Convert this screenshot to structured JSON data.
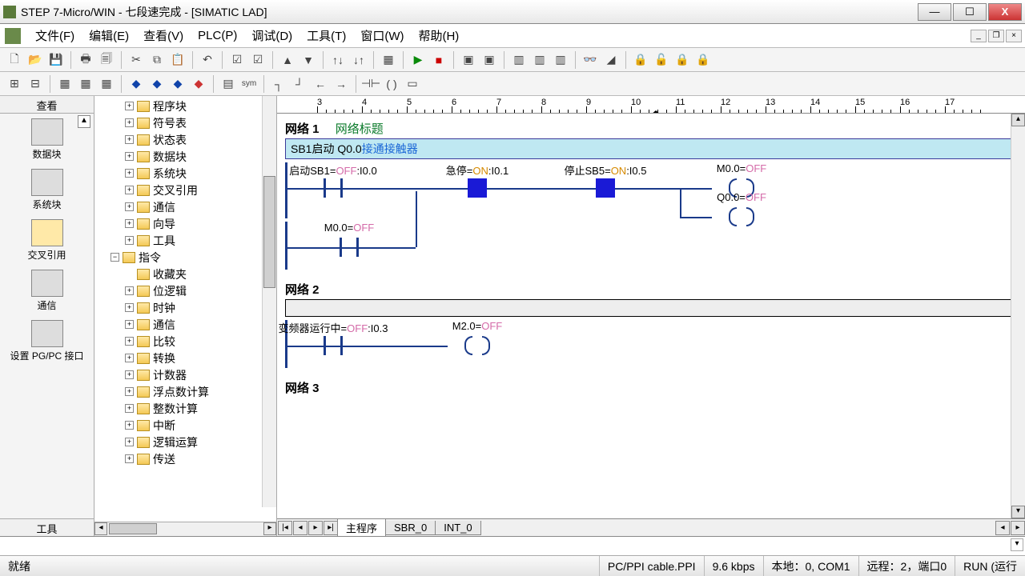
{
  "titlebar": {
    "text": "STEP 7-Micro/WIN - 七段速完成 - [SIMATIC LAD]"
  },
  "menu": {
    "file": "文件(F)",
    "edit": "编辑(E)",
    "view": "查看(V)",
    "plc": "PLC(P)",
    "debug": "调试(D)",
    "tools": "工具(T)",
    "window": "窗口(W)",
    "help": "帮助(H)"
  },
  "left_nav": {
    "title": "查看",
    "footer": "工具",
    "items": [
      {
        "label": "数据块"
      },
      {
        "label": "系统块"
      },
      {
        "label": "交叉引用"
      },
      {
        "label": "通信"
      },
      {
        "label": "设置 PG/PC 接口"
      }
    ]
  },
  "tree": [
    {
      "label": "程序块",
      "depth": 2,
      "exp": "+"
    },
    {
      "label": "符号表",
      "depth": 2,
      "exp": "+"
    },
    {
      "label": "状态表",
      "depth": 2,
      "exp": "+"
    },
    {
      "label": "数据块",
      "depth": 2,
      "exp": "+"
    },
    {
      "label": "系统块",
      "depth": 2,
      "exp": "+"
    },
    {
      "label": "交叉引用",
      "depth": 2,
      "exp": "+"
    },
    {
      "label": "通信",
      "depth": 2,
      "exp": "+"
    },
    {
      "label": "向导",
      "depth": 2,
      "exp": "+"
    },
    {
      "label": "工具",
      "depth": 2,
      "exp": "+"
    },
    {
      "label": "指令",
      "depth": 1,
      "exp": "−"
    },
    {
      "label": "收藏夹",
      "depth": 2,
      "exp": ""
    },
    {
      "label": "位逻辑",
      "depth": 2,
      "exp": "+"
    },
    {
      "label": "时钟",
      "depth": 2,
      "exp": "+"
    },
    {
      "label": "通信",
      "depth": 2,
      "exp": "+"
    },
    {
      "label": "比较",
      "depth": 2,
      "exp": "+"
    },
    {
      "label": "转换",
      "depth": 2,
      "exp": "+"
    },
    {
      "label": "计数器",
      "depth": 2,
      "exp": "+"
    },
    {
      "label": "浮点数计算",
      "depth": 2,
      "exp": "+"
    },
    {
      "label": "整数计算",
      "depth": 2,
      "exp": "+"
    },
    {
      "label": "中断",
      "depth": 2,
      "exp": "+"
    },
    {
      "label": "逻辑运算",
      "depth": 2,
      "exp": "+"
    },
    {
      "label": "传送",
      "depth": 2,
      "exp": "+"
    }
  ],
  "ruler": [
    "3",
    "4",
    "5",
    "6",
    "7",
    "8",
    "9",
    "10",
    "11",
    "12",
    "13",
    "14",
    "15",
    "16",
    "17"
  ],
  "networks": {
    "n1": {
      "title": "网络 1",
      "label": "网络标题",
      "comment_pre": "SB1启动 Q0.0",
      "comment_hl": "接通接触器",
      "c1": "启动SB1=",
      "c1s": "OFF",
      "c1a": ":I0.0",
      "c2": "急停=",
      "c2s": "ON",
      "c2a": ":I0.1",
      "c3": "停止SB5=",
      "c3s": "ON",
      "c3a": ":I0.5",
      "o1": "M0.0=",
      "o1s": "OFF",
      "p1": "M0.0=",
      "p1s": "OFF",
      "o2": "Q0.0=",
      "o2s": "OFF"
    },
    "n2": {
      "title": "网络 2",
      "c1": "变频器运行中=",
      "c1s": "OFF",
      "c1a": ":I0.3",
      "o1": "M2.0=",
      "o1s": "OFF"
    },
    "n3": {
      "title": "网络 3"
    }
  },
  "tabs": {
    "main": "主程序",
    "sbr": "SBR_0",
    "int": "INT_0"
  },
  "status": {
    "ready": "就绪",
    "cable": "PC/PPI cable.PPI",
    "baud": "9.6 kbps",
    "local": "本地：0, COM1",
    "remote": "远程：2，端口0",
    "run": "RUN (运行"
  }
}
